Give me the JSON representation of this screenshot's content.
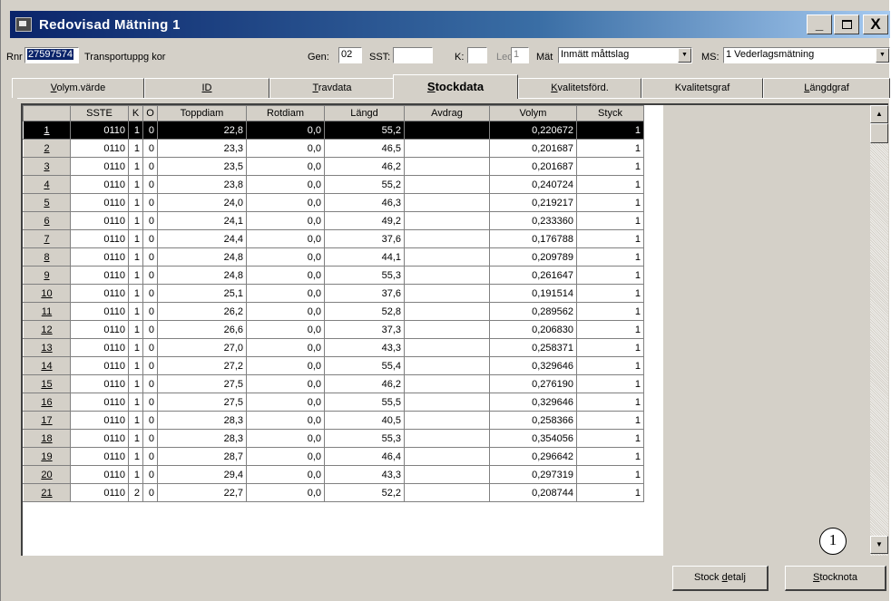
{
  "window": {
    "title": "Redovisad Mätning  1",
    "min_glyph": "_",
    "close_glyph": "X"
  },
  "fields": {
    "rnr_label": "Rnr",
    "rnr_value": "27597574",
    "transport_label": "Transportuppg kor",
    "gen_label": "Gen:",
    "gen_value": "02",
    "sst_label": "SST:",
    "sst_value": "",
    "k_label": "K:",
    "k_value": "",
    "led_label": "Led",
    "led_value": "1",
    "mat_label": "Mät",
    "mat_value": "Inmätt måttslag",
    "ms_label": "MS:",
    "ms_value": "1 Vederlagsmätning"
  },
  "tabs": [
    {
      "u": "V",
      "rest": "olym.värde"
    },
    {
      "u": "",
      "rest": "ID"
    },
    {
      "u": "T",
      "rest": "ravdata"
    },
    {
      "u": "S",
      "rest": "tockdata"
    },
    {
      "u": "K",
      "rest": "valitetsförd."
    },
    {
      "u": "",
      "rest": "Kvalitetsgraf"
    },
    {
      "u": "L",
      "rest": "ängdgraf"
    }
  ],
  "grid": {
    "headers": [
      "SSTE",
      "K",
      "O",
      "Toppdiam",
      "Rotdiam",
      "Längd",
      "Avdrag",
      "Volym",
      "Styck"
    ],
    "rows": [
      [
        "1",
        "0110",
        "1",
        "0",
        "22,8",
        "0,0",
        "55,2",
        "",
        "0,220672",
        "1"
      ],
      [
        "2",
        "0110",
        "1",
        "0",
        "23,3",
        "0,0",
        "46,5",
        "",
        "0,201687",
        "1"
      ],
      [
        "3",
        "0110",
        "1",
        "0",
        "23,5",
        "0,0",
        "46,2",
        "",
        "0,201687",
        "1"
      ],
      [
        "4",
        "0110",
        "1",
        "0",
        "23,8",
        "0,0",
        "55,2",
        "",
        "0,240724",
        "1"
      ],
      [
        "5",
        "0110",
        "1",
        "0",
        "24,0",
        "0,0",
        "46,3",
        "",
        "0,219217",
        "1"
      ],
      [
        "6",
        "0110",
        "1",
        "0",
        "24,1",
        "0,0",
        "49,2",
        "",
        "0,233360",
        "1"
      ],
      [
        "7",
        "0110",
        "1",
        "0",
        "24,4",
        "0,0",
        "37,6",
        "",
        "0,176788",
        "1"
      ],
      [
        "8",
        "0110",
        "1",
        "0",
        "24,8",
        "0,0",
        "44,1",
        "",
        "0,209789",
        "1"
      ],
      [
        "9",
        "0110",
        "1",
        "0",
        "24,8",
        "0,0",
        "55,3",
        "",
        "0,261647",
        "1"
      ],
      [
        "10",
        "0110",
        "1",
        "0",
        "25,1",
        "0,0",
        "37,6",
        "",
        "0,191514",
        "1"
      ],
      [
        "11",
        "0110",
        "1",
        "0",
        "26,2",
        "0,0",
        "52,8",
        "",
        "0,289562",
        "1"
      ],
      [
        "12",
        "0110",
        "1",
        "0",
        "26,6",
        "0,0",
        "37,3",
        "",
        "0,206830",
        "1"
      ],
      [
        "13",
        "0110",
        "1",
        "0",
        "27,0",
        "0,0",
        "43,3",
        "",
        "0,258371",
        "1"
      ],
      [
        "14",
        "0110",
        "1",
        "0",
        "27,2",
        "0,0",
        "55,4",
        "",
        "0,329646",
        "1"
      ],
      [
        "15",
        "0110",
        "1",
        "0",
        "27,5",
        "0,0",
        "46,2",
        "",
        "0,276190",
        "1"
      ],
      [
        "16",
        "0110",
        "1",
        "0",
        "27,5",
        "0,0",
        "55,5",
        "",
        "0,329646",
        "1"
      ],
      [
        "17",
        "0110",
        "1",
        "0",
        "28,3",
        "0,0",
        "40,5",
        "",
        "0,258366",
        "1"
      ],
      [
        "18",
        "0110",
        "1",
        "0",
        "28,3",
        "0,0",
        "55,3",
        "",
        "0,354056",
        "1"
      ],
      [
        "19",
        "0110",
        "1",
        "0",
        "28,7",
        "0,0",
        "46,4",
        "",
        "0,296642",
        "1"
      ],
      [
        "20",
        "0110",
        "1",
        "0",
        "29,4",
        "0,0",
        "43,3",
        "",
        "0,297319",
        "1"
      ],
      [
        "21",
        "0110",
        "2",
        "0",
        "22,7",
        "0,0",
        "52,2",
        "",
        "0,208744",
        "1"
      ]
    ],
    "selected_row": 0
  },
  "buttons": {
    "stock_detail_pre": "Stock ",
    "stock_detail_u": "d",
    "stock_detail_post": "etalj",
    "stocknota_u": "S",
    "stocknota_post": "tocknota"
  },
  "callout": "1",
  "colors": {
    "title_gradient_start": "#0a246a",
    "title_gradient_end": "#a6caf0",
    "window_face": "#d4d0c8",
    "selection": "#000000"
  }
}
